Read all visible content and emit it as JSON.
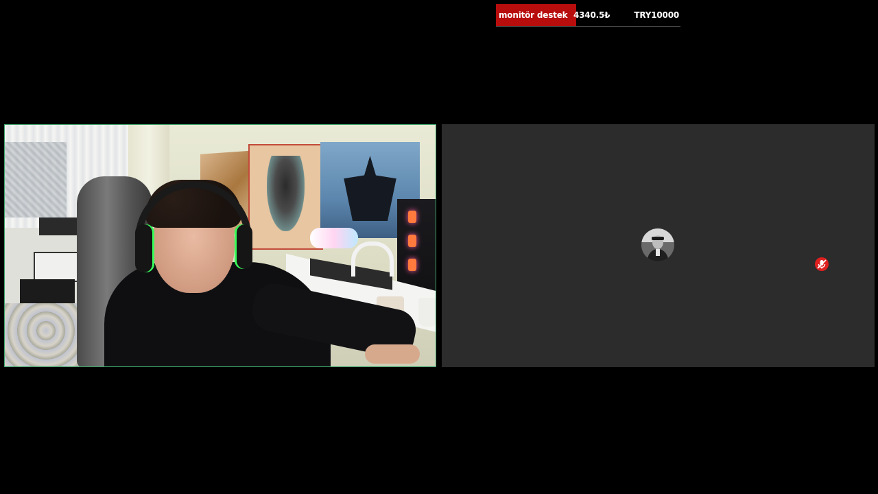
{
  "donation_goal": {
    "title": "monitör destek",
    "current": "4340.5₺",
    "target": "TRY10000",
    "progress_fraction": 0.434,
    "bar_color": "#b80d0d"
  },
  "tiles": {
    "camera": {
      "border_color": "#3fa36b"
    },
    "participant": {
      "background_color": "#2c2c2c",
      "avatar_icon": "user-avatar",
      "status_icon": "mic-muted-icon",
      "status_color": "#e02020"
    }
  }
}
